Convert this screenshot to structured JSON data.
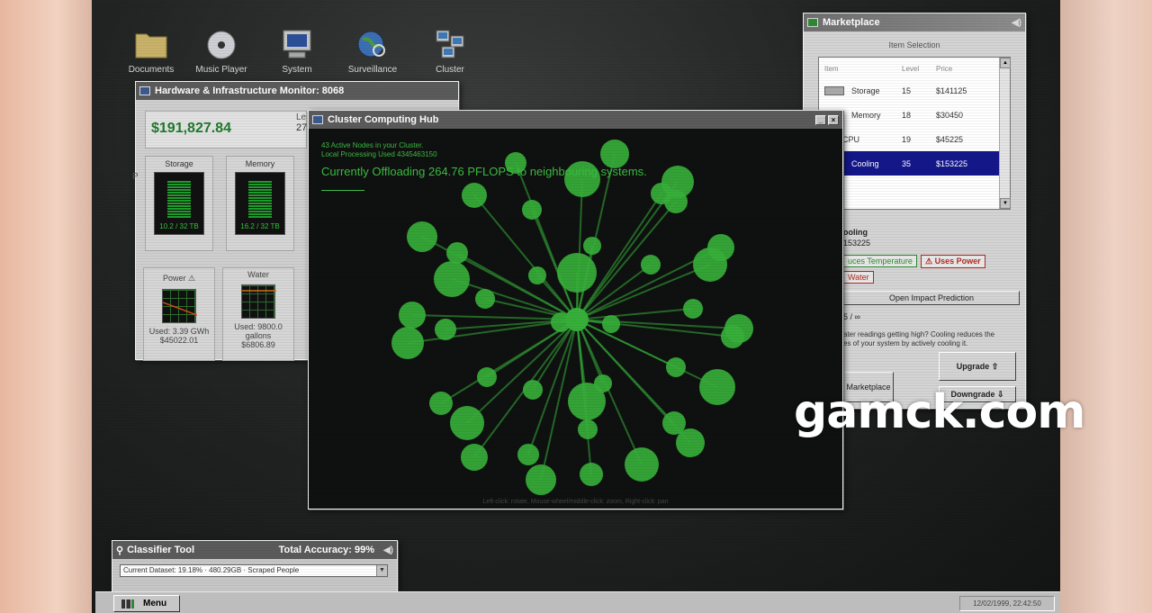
{
  "desktop_icons": [
    {
      "label": "Documents",
      "icon": "folder-icon"
    },
    {
      "label": "Music Player",
      "icon": "cd-icon"
    },
    {
      "label": "System",
      "icon": "computer-icon"
    },
    {
      "label": "Surveillance",
      "icon": "globe-search-icon"
    },
    {
      "label": "Cluster",
      "icon": "network-computers-icon"
    }
  ],
  "hw_monitor": {
    "title": "Hardware & Infrastructure Monitor: 8068",
    "money": "$191,827.84",
    "level_partial": "Le",
    "level_value": "27",
    "storage": {
      "label": "Storage",
      "value": "10.2 / 32 TB"
    },
    "memory": {
      "label": "Memory",
      "value": "16.2 / 32 TB"
    },
    "side_letter": "P",
    "power": {
      "label": "Power ⚠",
      "used": "Used: 3.39 GWh",
      "cost": "$45022.01"
    },
    "water": {
      "label": "Water",
      "used": "Used: 9800.0 gallons",
      "cost": "$6806.89"
    }
  },
  "cluster_hub": {
    "title": "Cluster Computing Hub",
    "line1": "43 Active Nodes in your Cluster.",
    "line2": "Local Processing Used 4345463150",
    "offload": "Currently Offloading 264.76 PFLOPS to neighbouring systems.",
    "hint": "Left-click: rotate, Mouse-wheel/middle-click: zoom, Right-click: pan",
    "node_color": "#37b03a"
  },
  "marketplace": {
    "title": "Marketplace",
    "section": "Item Selection",
    "columns": [
      "Item",
      "Level",
      "Price"
    ],
    "items": [
      {
        "name": "Storage",
        "level": "15",
        "price": "$141125"
      },
      {
        "name": "Memory",
        "level": "18",
        "price": "$30450"
      },
      {
        "name": "CPU",
        "level": "19",
        "price": "$45225"
      },
      {
        "name": "Cooling",
        "level": "35",
        "price": "$153225"
      }
    ],
    "selected_name": "ooling",
    "selected_price": "153225",
    "badge_temp": "uces Temperature",
    "badge_power": "⚠ Uses Power",
    "badge_water": "Water",
    "impact_button": "Open Impact Prediction",
    "ratio": "5 / ∞",
    "desc_line1": "ater readings getting high? Cooling reduces the",
    "desc_line2": "es of your system by actively cooling it.",
    "market_button": "Marketplace",
    "upgrade_button": "Upgrade ⇧",
    "downgrade_button": "Downgrade ⇩",
    "selection_color": "#14178a"
  },
  "classifier": {
    "title": "Classifier Tool",
    "accuracy": "Total Accuracy: 99%",
    "dataset": "Current Dataset: 19.18% · 480.29GB · Scraped People"
  },
  "taskbar": {
    "menu": "Menu",
    "clock": "12/02/1999, 22:42:50"
  },
  "watermark": "gamck.com"
}
